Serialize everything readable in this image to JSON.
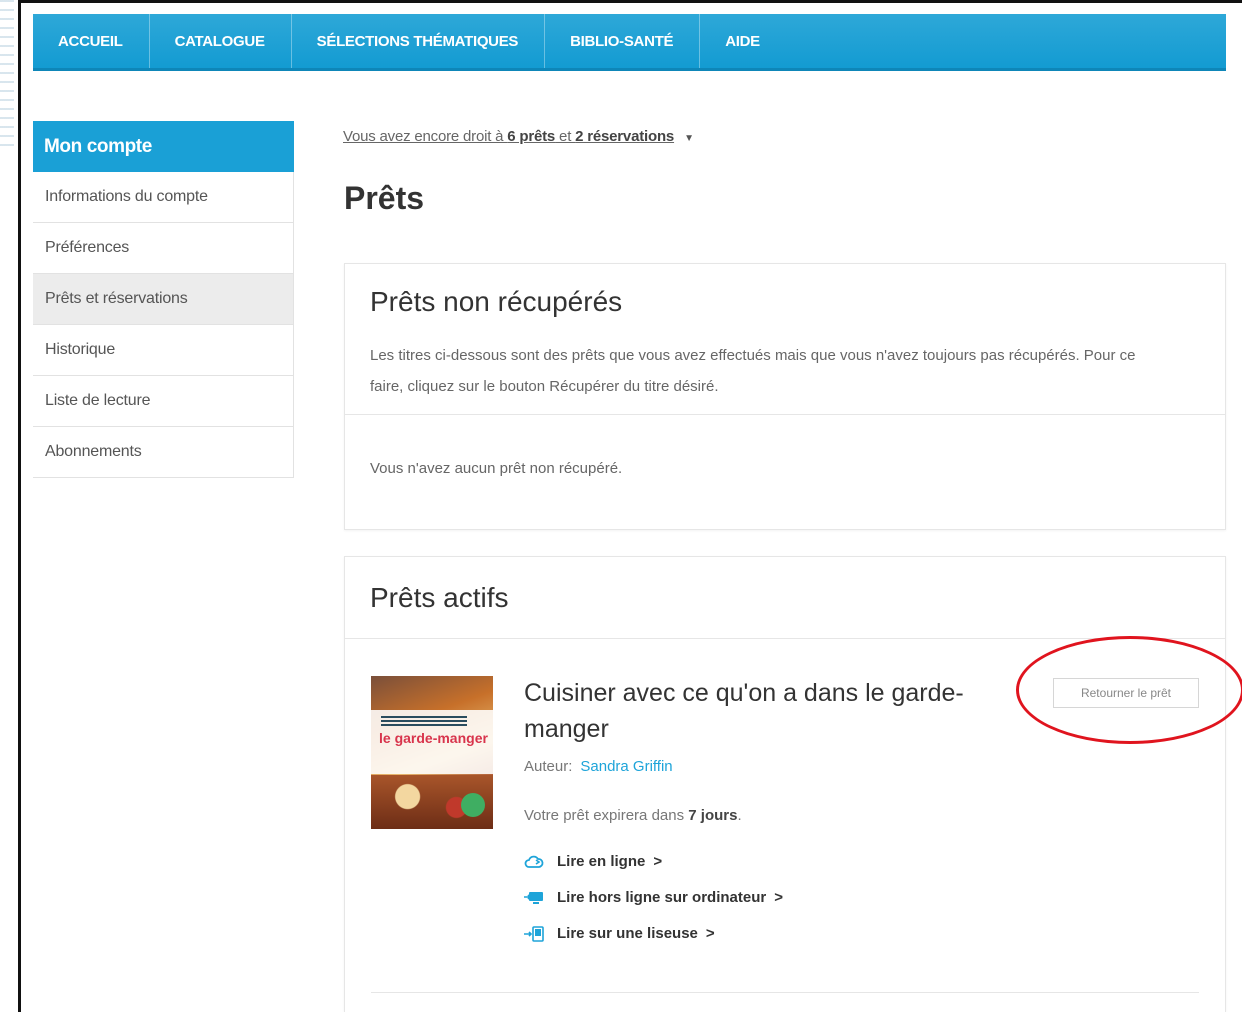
{
  "nav": {
    "items": [
      "ACCUEIL",
      "CATALOGUE",
      "SÉLECTIONS THÉMATIQUES",
      "BIBLIO-SANTÉ",
      "AIDE"
    ]
  },
  "sidebar": {
    "header": "Mon compte",
    "items": [
      {
        "label": "Informations du compte",
        "active": false
      },
      {
        "label": "Préférences",
        "active": false
      },
      {
        "label": "Prêts et réservations",
        "active": true
      },
      {
        "label": "Historique",
        "active": false
      },
      {
        "label": "Liste de lecture",
        "active": false
      },
      {
        "label": "Abonnements",
        "active": false
      }
    ]
  },
  "quota": {
    "prefix": "Vous avez encore droit à ",
    "loans": "6 prêts",
    "middle": " et ",
    "reservations": "2 réservations"
  },
  "page": {
    "title": "Prêts"
  },
  "unclaimed": {
    "title": "Prêts non récupérés",
    "description": "Les titres ci-dessous sont des prêts que vous avez effectués mais que vous n'avez toujours pas récupérés. Pour ce faire, cliquez sur le bouton Récupérer du titre désiré.",
    "empty_message": "Vous n'avez aucun prêt non récupéré."
  },
  "active": {
    "title": "Prêts actifs",
    "loan": {
      "cover_title": "le garde-manger",
      "title": "Cuisiner avec ce qu'on a dans le garde-manger",
      "author_label": "Auteur:",
      "author": "Sandra Griffin",
      "expire_prefix": "Votre prêt expirera dans ",
      "expire_value": "7 jours",
      "expire_suffix": ".",
      "return_button": "Retourner le prêt",
      "links": [
        {
          "label": "Lire en ligne",
          "icon": "cloud-icon"
        },
        {
          "label": "Lire hors ligne sur ordinateur",
          "icon": "computer-icon"
        },
        {
          "label": "Lire sur une liseuse",
          "icon": "ereader-icon"
        }
      ]
    }
  },
  "colors": {
    "accent": "#1aa0d6",
    "highlight": "#e0141e"
  }
}
